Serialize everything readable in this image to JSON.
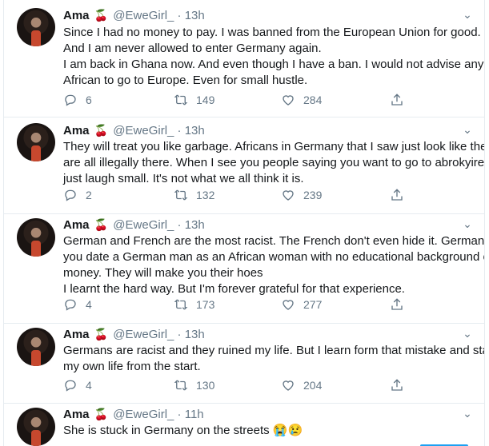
{
  "tweets": [
    {
      "name": "Ama",
      "cherry": "🍒",
      "handle": "@EweGirl_",
      "time": "· 13h",
      "lines": [
        "Since I had no money to pay. I was banned from the European Union for good.",
        "And I am never allowed to enter Germany again.",
        "I am back in Ghana now. And even though I have a ban. I would not advise any",
        "African to go to Europe. Even for small hustle."
      ],
      "replies": "6",
      "retweets": "149",
      "likes": "284"
    },
    {
      "name": "Ama",
      "cherry": "🍒",
      "handle": "@EweGirl_",
      "time": "· 13h",
      "lines": [
        "They will treat you like garbage. Africans in Germany that I saw just look like they",
        "are all illegally there. When I see you people saying you want to go to abrokyire. I",
        "just laugh small. It's not what we all think it is."
      ],
      "replies": "2",
      "retweets": "132",
      "likes": "239"
    },
    {
      "name": "Ama",
      "cherry": "🍒",
      "handle": "@EweGirl_",
      "time": "· 13h",
      "lines": [
        "German and French are the most racist. The French don't even hide it. Germans if",
        "you date a German man as an African woman with no educational background or",
        "money. They will make you their hoes",
        "I learnt the hard way. But I'm forever grateful for that experience."
      ],
      "replies": "4",
      "retweets": "173",
      "likes": "277"
    },
    {
      "name": "Ama",
      "cherry": "🍒",
      "handle": "@EweGirl_",
      "time": "· 13h",
      "lines": [
        "Germans are racist and they ruined my life. But I learn form that mistake and start",
        "my own life from the start."
      ],
      "replies": "4",
      "retweets": "130",
      "likes": "204"
    },
    {
      "name": "Ama",
      "cherry": "🍒",
      "handle": "@EweGirl_",
      "time": "· 11h",
      "lines": [
        "She is stuck in Germany on the streets 😭😢"
      ]
    }
  ],
  "icons": {
    "reply": "reply-icon",
    "retweet": "retweet-icon",
    "like": "heart-icon",
    "share": "share-icon",
    "caret": "chevron-down-icon"
  },
  "colors": {
    "text": "#14171a",
    "muted": "#657786",
    "border": "#e6ecf0"
  }
}
